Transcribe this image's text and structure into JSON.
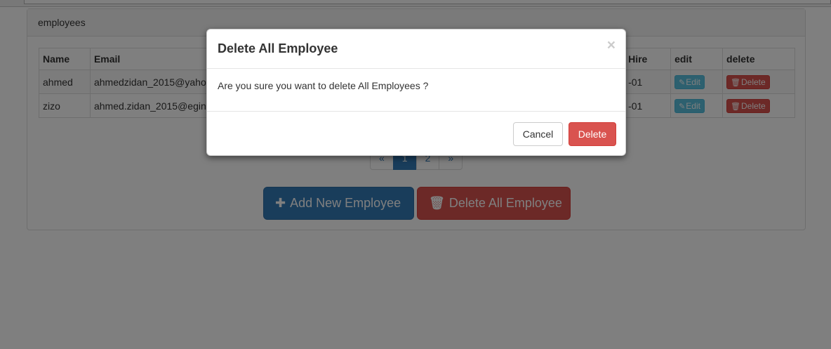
{
  "panel": {
    "heading": "employees"
  },
  "table": {
    "headers": {
      "name": "Name",
      "email": "Email",
      "hire": "Hire",
      "edit": "edit",
      "delete": "delete"
    },
    "rows": [
      {
        "name": "ahmed",
        "email": "ahmedzidan_2015@yaho",
        "hire": "-01",
        "edit": "Edit",
        "delete": "Delete"
      },
      {
        "name": "zizo",
        "email": "ahmed.zidan_2015@egin",
        "hire": "-01",
        "edit": "Edit",
        "delete": "Delete"
      }
    ]
  },
  "pagination": {
    "prev": "«",
    "pages": [
      "1",
      "2"
    ],
    "next": "»",
    "active_page": "1"
  },
  "actions": {
    "add_label": "Add New Employee",
    "delete_all_label": "Delete All Employee"
  },
  "icons": {
    "add": "plus-icon",
    "delete_all": "trash-icon",
    "edit": "edit-icon",
    "delete": "trash-icon",
    "close": "close-icon"
  },
  "modal": {
    "title": "Delete All Employee",
    "close_symbol": "×",
    "body": "Are you sure you want to delete All Employees ?",
    "cancel_label": "Cancel",
    "confirm_label": "Delete"
  },
  "colors": {
    "primary": "#337ab7",
    "danger": "#d9534f",
    "info": "#5bc0de"
  }
}
